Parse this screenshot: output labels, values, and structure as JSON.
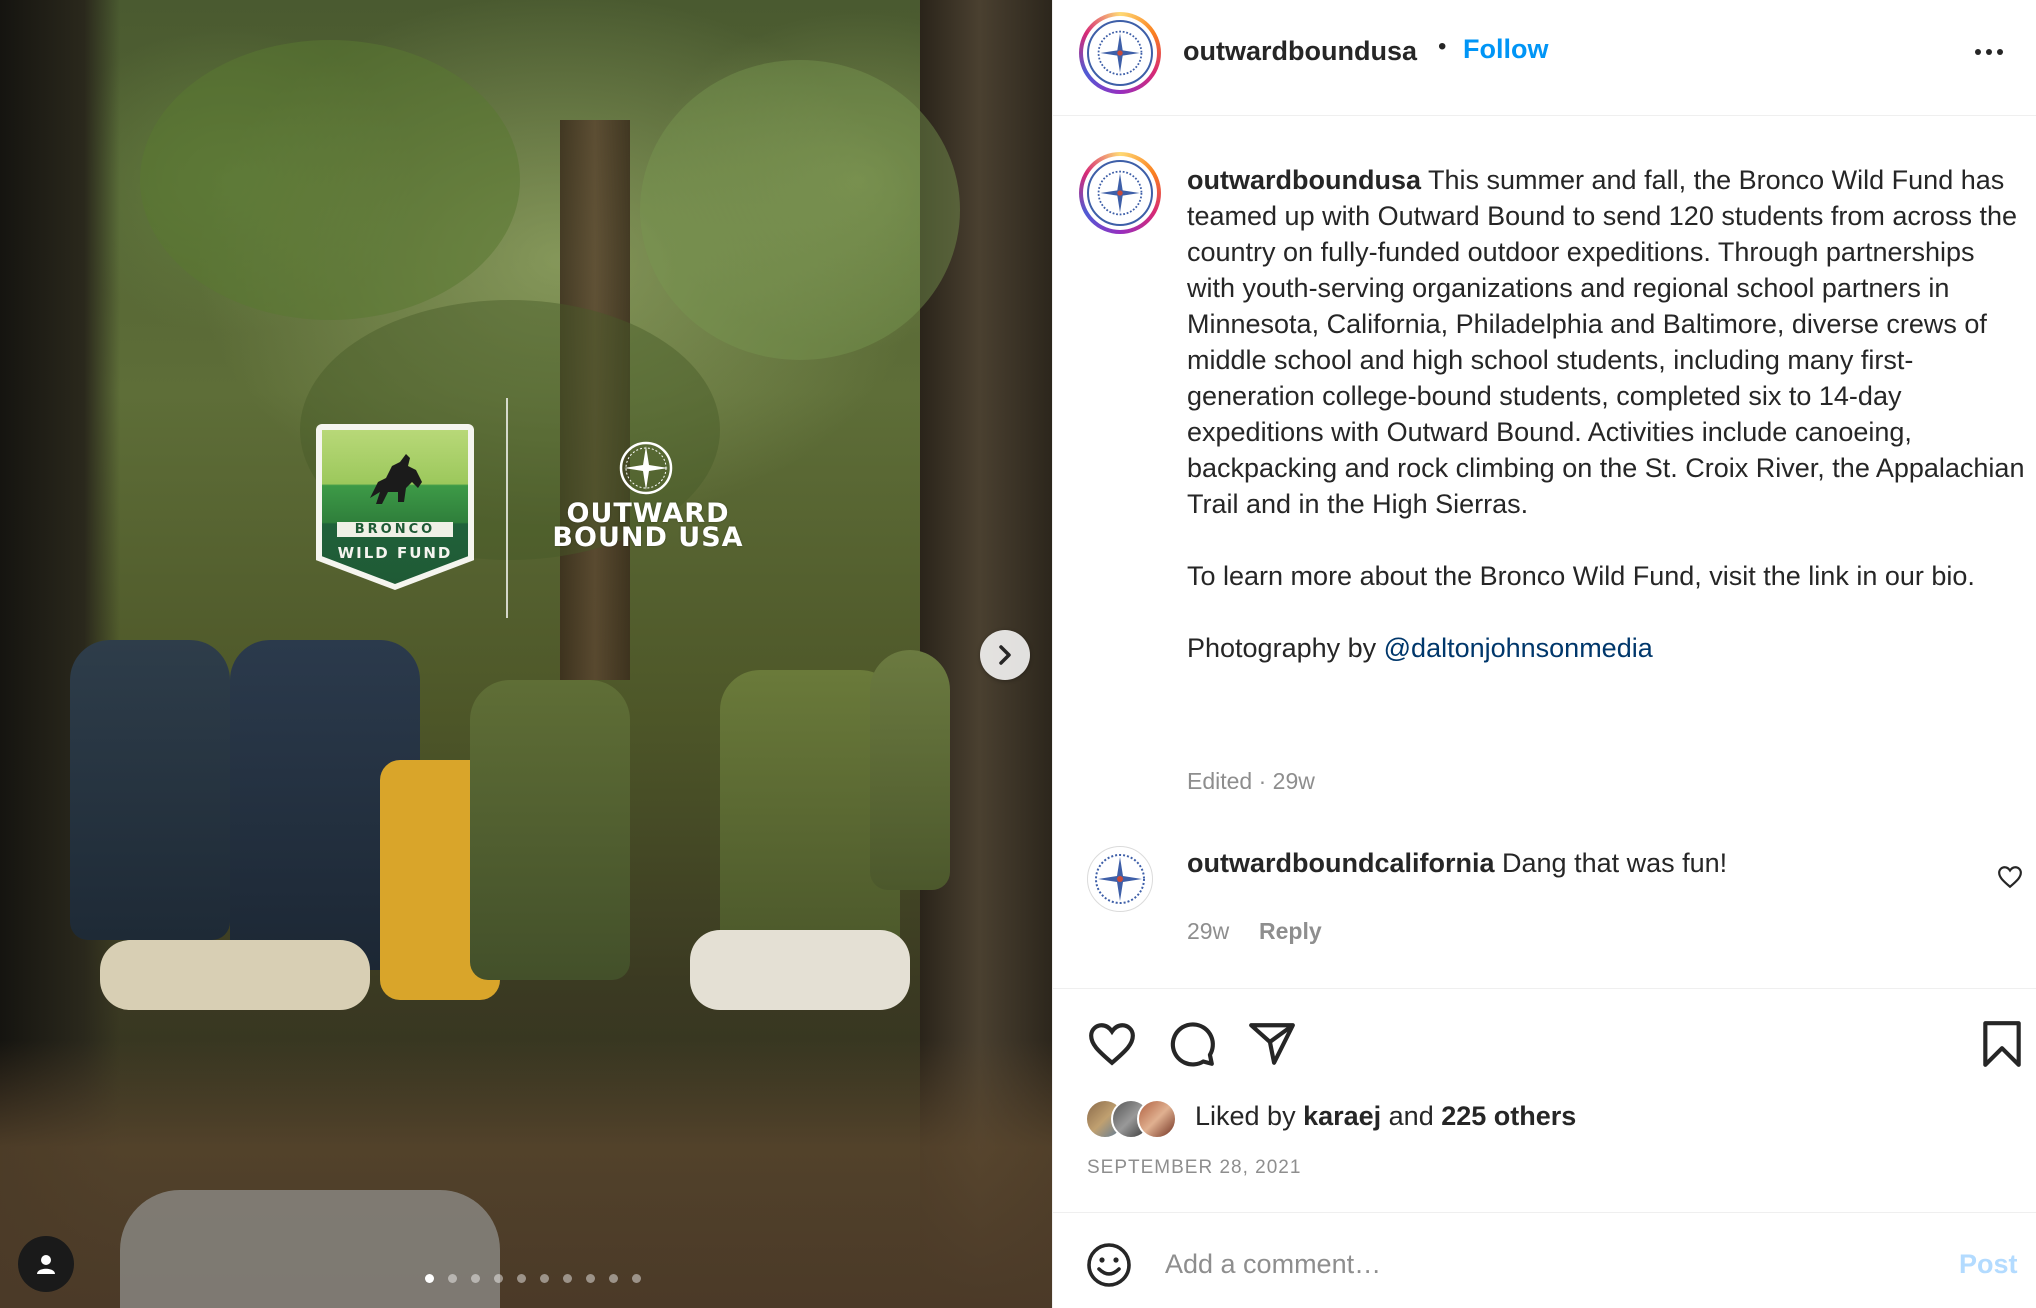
{
  "media": {
    "logo_bronco_word": "BRONCO",
    "logo_wild_fund": "WILD FUND",
    "logo_outward": "OUTWARD",
    "logo_bound_usa": "BOUND USA",
    "carousel_count": 10,
    "carousel_active_index": 0
  },
  "header": {
    "username": "outwardboundusa",
    "separator": "•",
    "follow_label": "Follow"
  },
  "caption": {
    "username": "outwardboundusa",
    "body": "This summer and fall, the Bronco Wild Fund has teamed up with Outward Bound to send 120 students from across the country on fully-funded outdoor expeditions. Through partnerships with youth-serving organizations and regional school partners in Minnesota, California, Philadelphia and Baltimore, diverse crews of middle school and high school students, including many first-generation college-bound students, completed six to 14-day expeditions with Outward Bound. Activities include canoeing, backpacking and rock climbing on the St. Croix River, the Appalachian Trail and in the High Sierras.",
    "para2": "To learn more about the Bronco Wild Fund, visit the link in our bio.",
    "para3_prefix": "Photography by ",
    "mention": "@daltonjohnsonmedia",
    "edited_time": "Edited · 29w"
  },
  "comment": {
    "username": "outwardboundcalifornia",
    "text": "Dang that was fun!",
    "time": "29w",
    "reply_label": "Reply"
  },
  "likes": {
    "prefix": "Liked by ",
    "user": "karaej",
    "middle": " and ",
    "others": "225 others"
  },
  "post_date": "SEPTEMBER 28, 2021",
  "add_comment": {
    "placeholder": "Add a comment…",
    "post_label": "Post"
  },
  "icons": {
    "like": "heart-icon",
    "comment": "comment-bubble-icon",
    "share": "paper-plane-icon",
    "save": "bookmark-icon",
    "emoji": "smiley-icon",
    "more": "more-dots-icon",
    "next": "chevron-right-icon",
    "user_tag": "person-icon"
  },
  "colors": {
    "link_blue": "#0095f6",
    "mention_navy": "#00376b",
    "muted_grey": "#8e8e8e",
    "post_disabled": "#b3dbff"
  }
}
